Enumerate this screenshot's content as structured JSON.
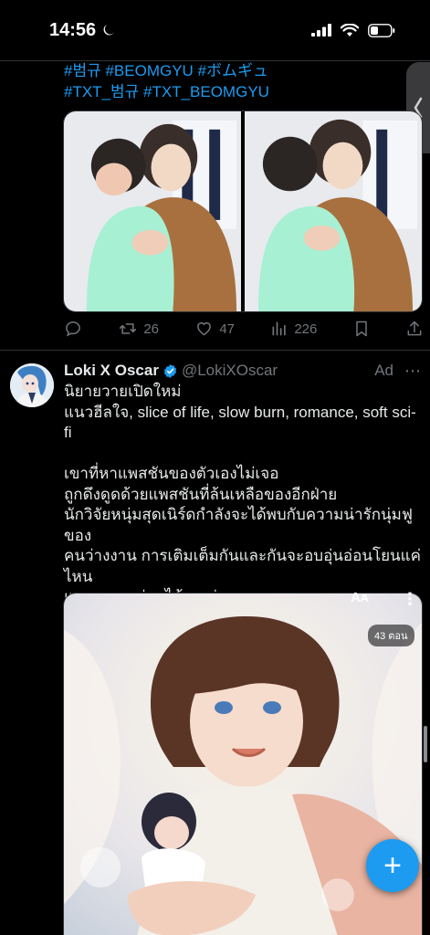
{
  "status_bar": {
    "time": "14:56"
  },
  "previous_tweet": {
    "hashtags_line1": "#범규 #BEOMGYU #ボムギュ",
    "hashtags_line2": "#TXT_범규 #TXT_BEOMGYU",
    "retweets": "26",
    "likes": "47",
    "views": "226"
  },
  "ad_tweet": {
    "author_name": "Loki X Oscar",
    "handle": "@LokiXOscar",
    "ad_label": "Ad",
    "body_lines": [
      "นิยายวายเปิดใหม่",
      "แนวฮีลใจ, slice of life, slow burn, romance, soft sci-",
      "fi",
      "",
      "เขาที่หาแพสชันของตัวเองไม่เจอ",
      "ถูกดึงดูดด้วยแพสชันที่ล้นเหลือของอีกฝ่าย",
      "นักวิจัยหนุ่มสุดเนิร์ดกำลังจะได้พบกับความน่ารักนุ่มฟูของ",
      "คนว่างงาน การเติมเต็มกันและกันจะอบอุ่นอ่อนโยนแค่",
      "ไหน",
      "แวะมาลองอ่านได้เลยค่า"
    ],
    "image_overlay": {
      "aa_label": "Aᴀ",
      "episodes": "43 ตอน"
    }
  },
  "fab": {
    "label": "+"
  },
  "colors": {
    "accent": "#1d9bf0",
    "background": "#000000",
    "muted": "#71767b"
  }
}
